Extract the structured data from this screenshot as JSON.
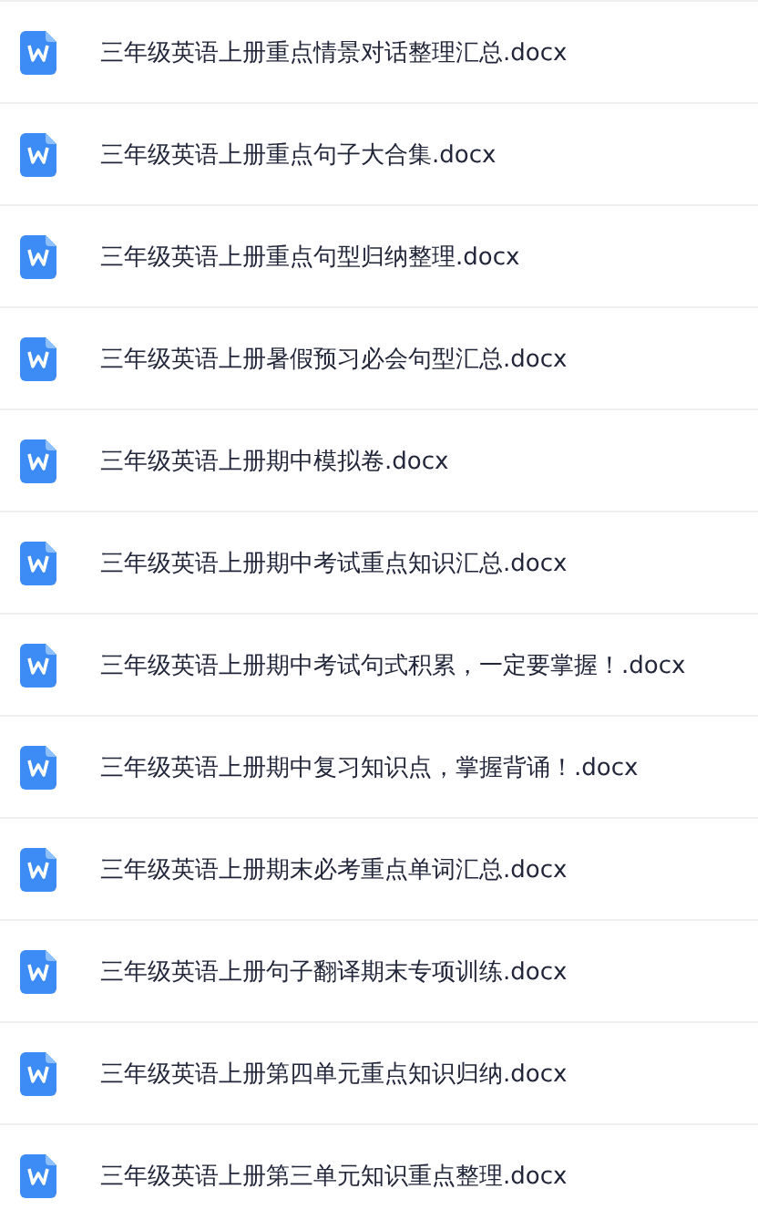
{
  "files": [
    {
      "name": "三年级英语上册重点情景对话整理汇总.docx"
    },
    {
      "name": "三年级英语上册重点句子大合集.docx"
    },
    {
      "name": "三年级英语上册重点句型归纳整理.docx"
    },
    {
      "name": "三年级英语上册暑假预习必会句型汇总.docx"
    },
    {
      "name": "三年级英语上册期中模拟卷.docx"
    },
    {
      "name": "三年级英语上册期中考试重点知识汇总.docx"
    },
    {
      "name": "三年级英语上册期中考试句式积累，一定要掌握！.docx"
    },
    {
      "name": "三年级英语上册期中复习知识点，掌握背诵！.docx"
    },
    {
      "name": "三年级英语上册期末必考重点单词汇总.docx"
    },
    {
      "name": "三年级英语上册句子翻译期末专项训练.docx"
    },
    {
      "name": "三年级英语上册第四单元重点知识归纳.docx"
    },
    {
      "name": "三年级英语上册第三单元知识重点整理.docx"
    }
  ]
}
